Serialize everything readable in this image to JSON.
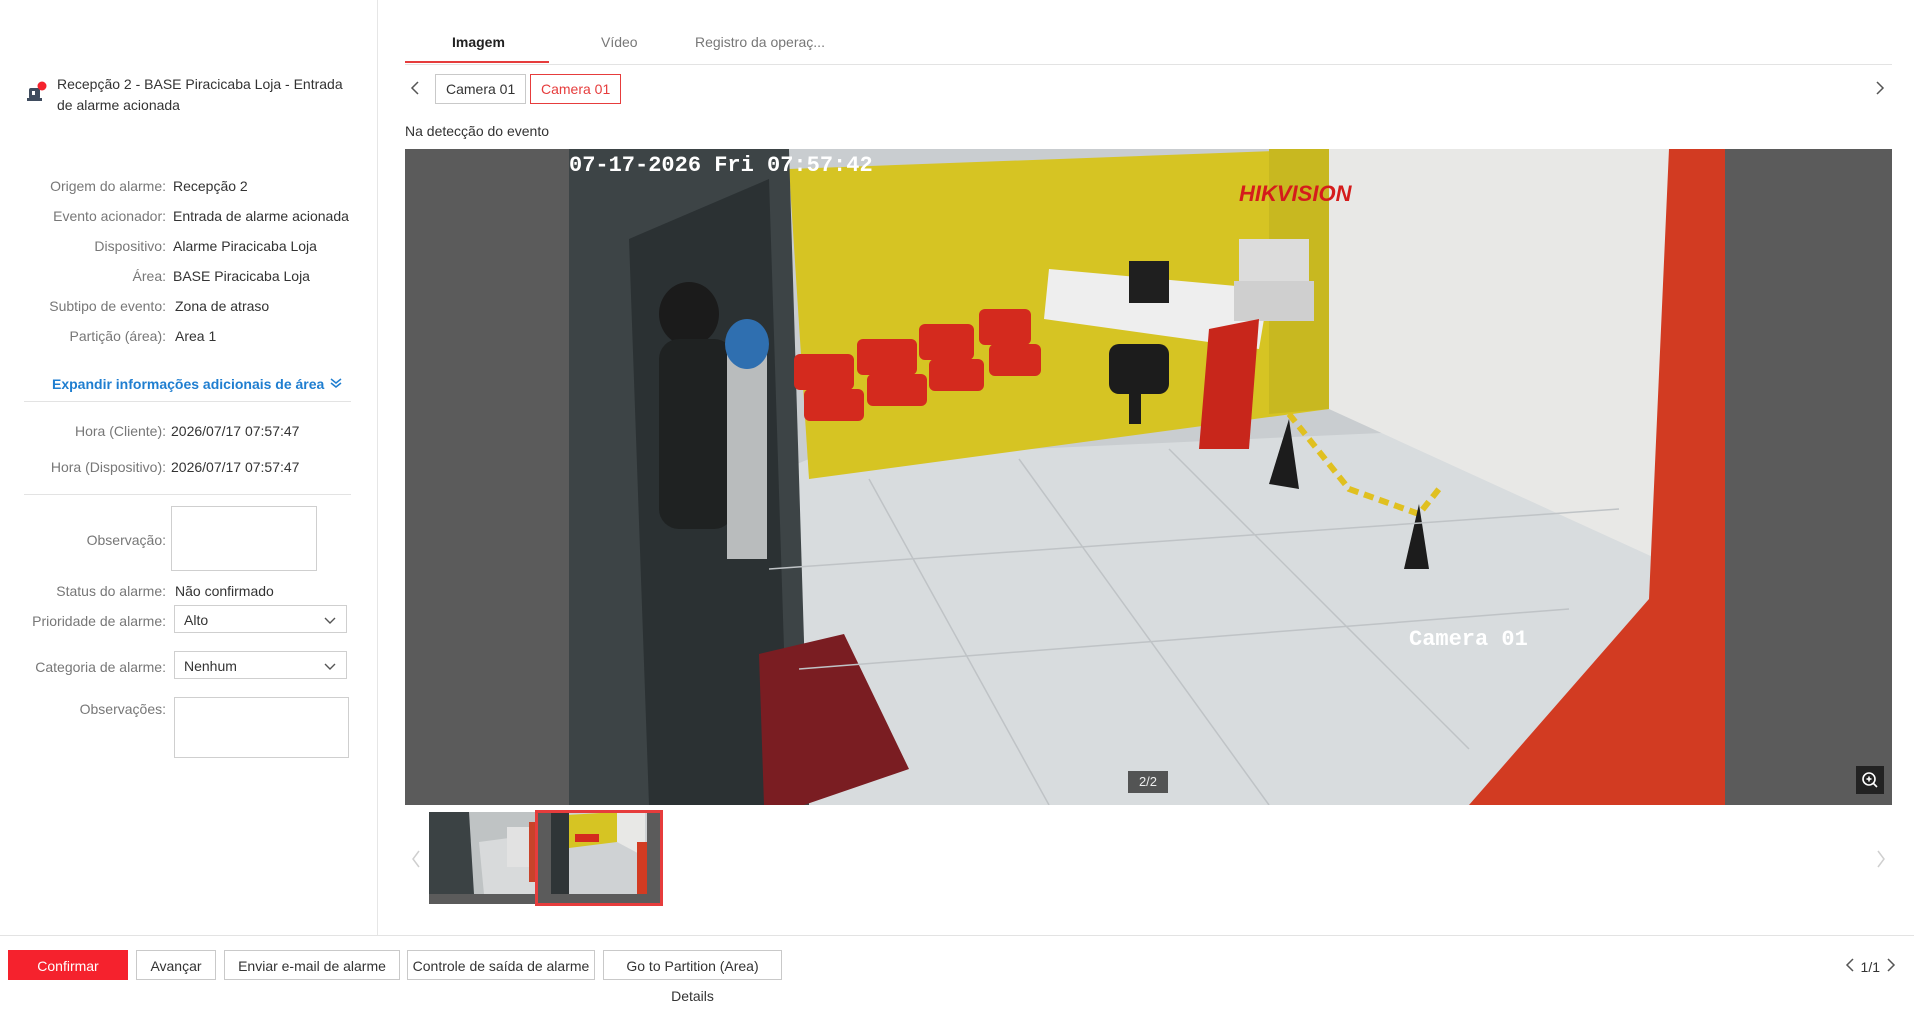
{
  "alarm": {
    "title": "Recepção 2 - BASE Piracicaba Loja - Entrada de alarme acionada"
  },
  "details": [
    {
      "label": "Origem do alarme:",
      "value": "Recepção 2"
    },
    {
      "label": "Evento acionador:",
      "value": "Entrada de alarme acionada"
    },
    {
      "label": "Dispositivo:",
      "value": "Alarme Piracicaba Loja"
    },
    {
      "label": "Área:",
      "value": "BASE Piracicaba Loja"
    },
    {
      "label": "Subtipo de evento:",
      "value": "Zona de atraso"
    },
    {
      "label": "Partição (área):",
      "value": "Area 1"
    }
  ],
  "expand_label": "Expandir informações adicionais de área",
  "times": [
    {
      "label": "Hora (Cliente):",
      "value": "2026/07/17 07:57:47"
    },
    {
      "label": "Hora (Dispositivo):",
      "value": "2026/07/17 07:57:47"
    }
  ],
  "form": {
    "observation_label": "Observação:",
    "status_label": "Status do alarme:",
    "status_value": "Não confirmado",
    "priority_label": "Prioridade de alarme:",
    "priority_value": "Alto",
    "category_label": "Categoria de alarme:",
    "category_value": "Nenhum",
    "notes_label": "Observações:"
  },
  "tabs": [
    "Imagem",
    "Vídeo",
    "Registro da operaç..."
  ],
  "cameras": [
    "Camera 01",
    "Camera 01"
  ],
  "event_caption": "Na detecção do evento",
  "image": {
    "osd_timestamp": "07-17-2026 Fri 07:57:42",
    "osd_brand": "HIKVISION",
    "osd_camera": "Camera 01",
    "page_indicator": "2/2"
  },
  "footer": {
    "confirm": "Confirmar",
    "next": "Avançar",
    "send_email": "Enviar e-mail de alarme",
    "output_control": "Controle de saída de alarme",
    "partition_details": "Go to Partition (Area) Details",
    "pager": "1/1"
  },
  "colors": {
    "accent": "#e63c3c",
    "primary_button": "#f5222d",
    "link": "#1f7ed0"
  }
}
